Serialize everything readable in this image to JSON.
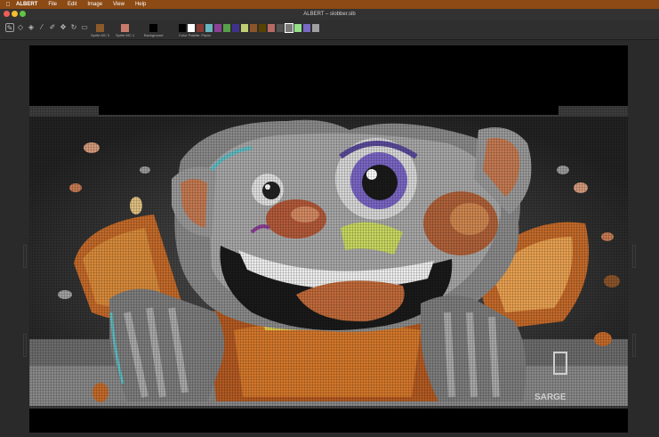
{
  "menubar": {
    "apple_icon": "apple-icon",
    "app_name": "ALBERT",
    "items": [
      "File",
      "Edit",
      "Image",
      "View",
      "Help"
    ]
  },
  "window": {
    "title": "ALBERT – slobber.slb",
    "controls": {
      "close": "#ec5f57",
      "minimize": "#f4bd33",
      "zoom": "#5ec545"
    }
  },
  "toolbar": {
    "tools": [
      {
        "name": "pencil-tool",
        "glyph": "✎",
        "selected": true
      },
      {
        "name": "eraser-tool",
        "glyph": "◇",
        "selected": false
      },
      {
        "name": "fill-tool",
        "glyph": "◈",
        "selected": false
      },
      {
        "name": "eyedropper-tool",
        "glyph": "⁄",
        "selected": false
      },
      {
        "name": "picker-tool",
        "glyph": "✐",
        "selected": false
      },
      {
        "name": "move-tool",
        "glyph": "✥",
        "selected": false
      },
      {
        "name": "rotate-tool",
        "glyph": "↻",
        "selected": false
      },
      {
        "name": "select-tool",
        "glyph": "▭",
        "selected": false
      }
    ],
    "color_slots": [
      {
        "label": "Sprite MC 0",
        "color": "#8b5a2b"
      },
      {
        "label": "Sprite MC 1",
        "color": "#c97b6b"
      },
      {
        "label": "Background",
        "color": "#000000"
      }
    ],
    "palette_label": "Color Palette: Pepto",
    "palette": [
      "#000000",
      "#ffffff",
      "#883932",
      "#67b6bd",
      "#8b3f96",
      "#55a049",
      "#40318d",
      "#bfce72",
      "#8b5429",
      "#574200",
      "#b86962",
      "#505050",
      "#787878",
      "#94e089",
      "#7869c4",
      "#9f9f9f"
    ],
    "palette_selected_index": 12
  },
  "canvas": {
    "image_name": "slobber artwork",
    "signature": "SARGE"
  }
}
